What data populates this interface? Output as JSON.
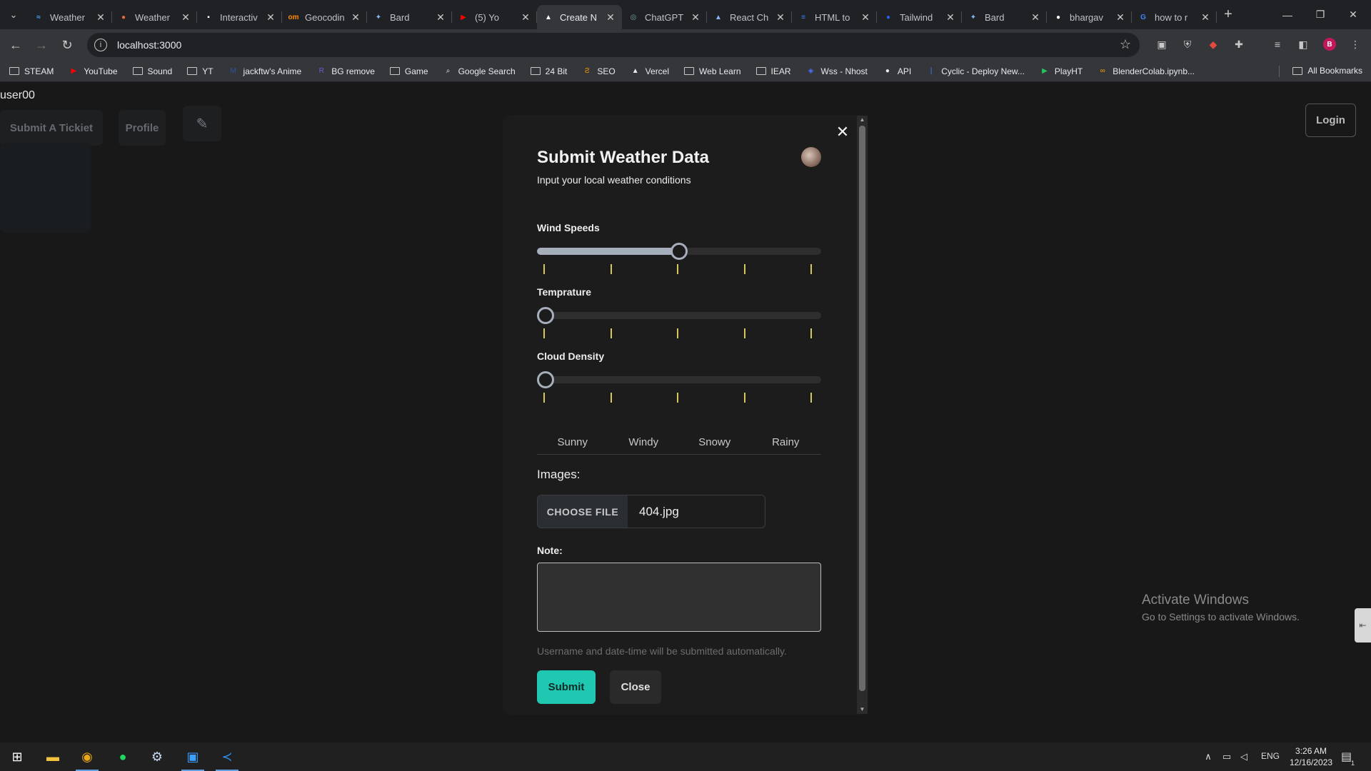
{
  "browser": {
    "tabs": [
      {
        "title": "Weather",
        "icon": "weather-app-icon",
        "color": "#4aa8ff",
        "glyph": "≈"
      },
      {
        "title": "Weather",
        "icon": "weather-dot-icon",
        "color": "#e86b3a",
        "glyph": "●"
      },
      {
        "title": "Interactiv",
        "icon": "page-icon",
        "color": "#ffffff",
        "glyph": "▪"
      },
      {
        "title": "Geocodin",
        "icon": "om-icon",
        "color": "#ff8a00",
        "glyph": "om"
      },
      {
        "title": "Bard",
        "icon": "bard-sparkle-icon",
        "color": "#8ab4f8",
        "glyph": "✦"
      },
      {
        "title": "(5) Yo",
        "icon": "youtube-icon",
        "color": "#ff0000",
        "glyph": "▶"
      },
      {
        "title": "Create N",
        "icon": "vercel-triangle-icon",
        "color": "#ffffff",
        "glyph": "▲"
      },
      {
        "title": "ChatGPT",
        "icon": "chatgpt-icon",
        "color": "#74aa9c",
        "glyph": "◎"
      },
      {
        "title": "React Ch",
        "icon": "react-icon",
        "color": "#8ab4f8",
        "glyph": "▲"
      },
      {
        "title": "HTML to",
        "icon": "html-icon",
        "color": "#3b82f6",
        "glyph": "≡"
      },
      {
        "title": "Tailwind",
        "icon": "tailwind-icon",
        "color": "#2563eb",
        "glyph": "●"
      },
      {
        "title": "Bard",
        "icon": "bard-sparkle-icon",
        "color": "#8ab4f8",
        "glyph": "✦"
      },
      {
        "title": "bhargav",
        "icon": "github-icon",
        "color": "#ffffff",
        "glyph": "●"
      },
      {
        "title": "how to r",
        "icon": "google-icon",
        "color": "#4285f4",
        "glyph": "G"
      }
    ],
    "active_tab_index": 6,
    "url": "localhost:3000",
    "profile_initial": "B",
    "bookmarks": [
      {
        "label": "STEAM",
        "icon": "folder-icon"
      },
      {
        "label": "YouTube",
        "icon": "youtube-icon"
      },
      {
        "label": "Sound",
        "icon": "folder-icon"
      },
      {
        "label": "YT",
        "icon": "folder-icon"
      },
      {
        "label": "jackftw's Anime",
        "icon": "mal-icon"
      },
      {
        "label": "BG remove",
        "icon": "remove-bg-icon"
      },
      {
        "label": "Game",
        "icon": "folder-icon"
      },
      {
        "label": "Google Search",
        "icon": "search-engine-icon"
      },
      {
        "label": "24 Bit",
        "icon": "folder-icon"
      },
      {
        "label": "SEO",
        "icon": "seo-icon"
      },
      {
        "label": "Vercel",
        "icon": "vercel-triangle-icon"
      },
      {
        "label": "Web Learn",
        "icon": "folder-icon"
      },
      {
        "label": "IEAR",
        "icon": "folder-icon"
      },
      {
        "label": "Wss - Nhost",
        "icon": "nhost-icon"
      },
      {
        "label": "API",
        "icon": "github-icon"
      },
      {
        "label": "Cyclic - Deploy New...",
        "icon": "cyclic-icon"
      },
      {
        "label": "PlayHT",
        "icon": "playht-icon"
      },
      {
        "label": "BlenderColab.ipynb...",
        "icon": "colab-icon"
      }
    ],
    "all_bookmarks_label": "All Bookmarks"
  },
  "page": {
    "username": "user00",
    "nav": {
      "submit_ticket": "Submit A Tickiet",
      "profile": "Profile"
    },
    "login_label": "Login"
  },
  "modal": {
    "title": "Submit Weather Data",
    "subtitle": "Input your local weather conditions",
    "sliders": [
      {
        "label": "Wind Speeds",
        "value": 0.5
      },
      {
        "label": "Temprature",
        "value": 0.0
      },
      {
        "label": "Cloud Density",
        "value": 0.0
      }
    ],
    "weather_tabs": [
      "Sunny",
      "Windy",
      "Snowy",
      "Rainy"
    ],
    "images_label": "Images:",
    "choose_file_label": "CHOOSE FILE",
    "file_name": "404.jpg",
    "note_label": "Note:",
    "note_value": "",
    "auto_note": "Username and date-time will be submitted automatically.",
    "submit_label": "Submit",
    "close_label": "Close"
  },
  "watermark": {
    "title": "Activate Windows",
    "subtitle": "Go to Settings to activate Windows."
  },
  "taskbar": {
    "language": "ENG",
    "time": "3:26 AM",
    "date": "12/16/2023",
    "notification_count": "1"
  },
  "colors": {
    "accent": "#1fc8b0",
    "slider_fill": "#a6adbb",
    "tick": "#d4c85a"
  }
}
